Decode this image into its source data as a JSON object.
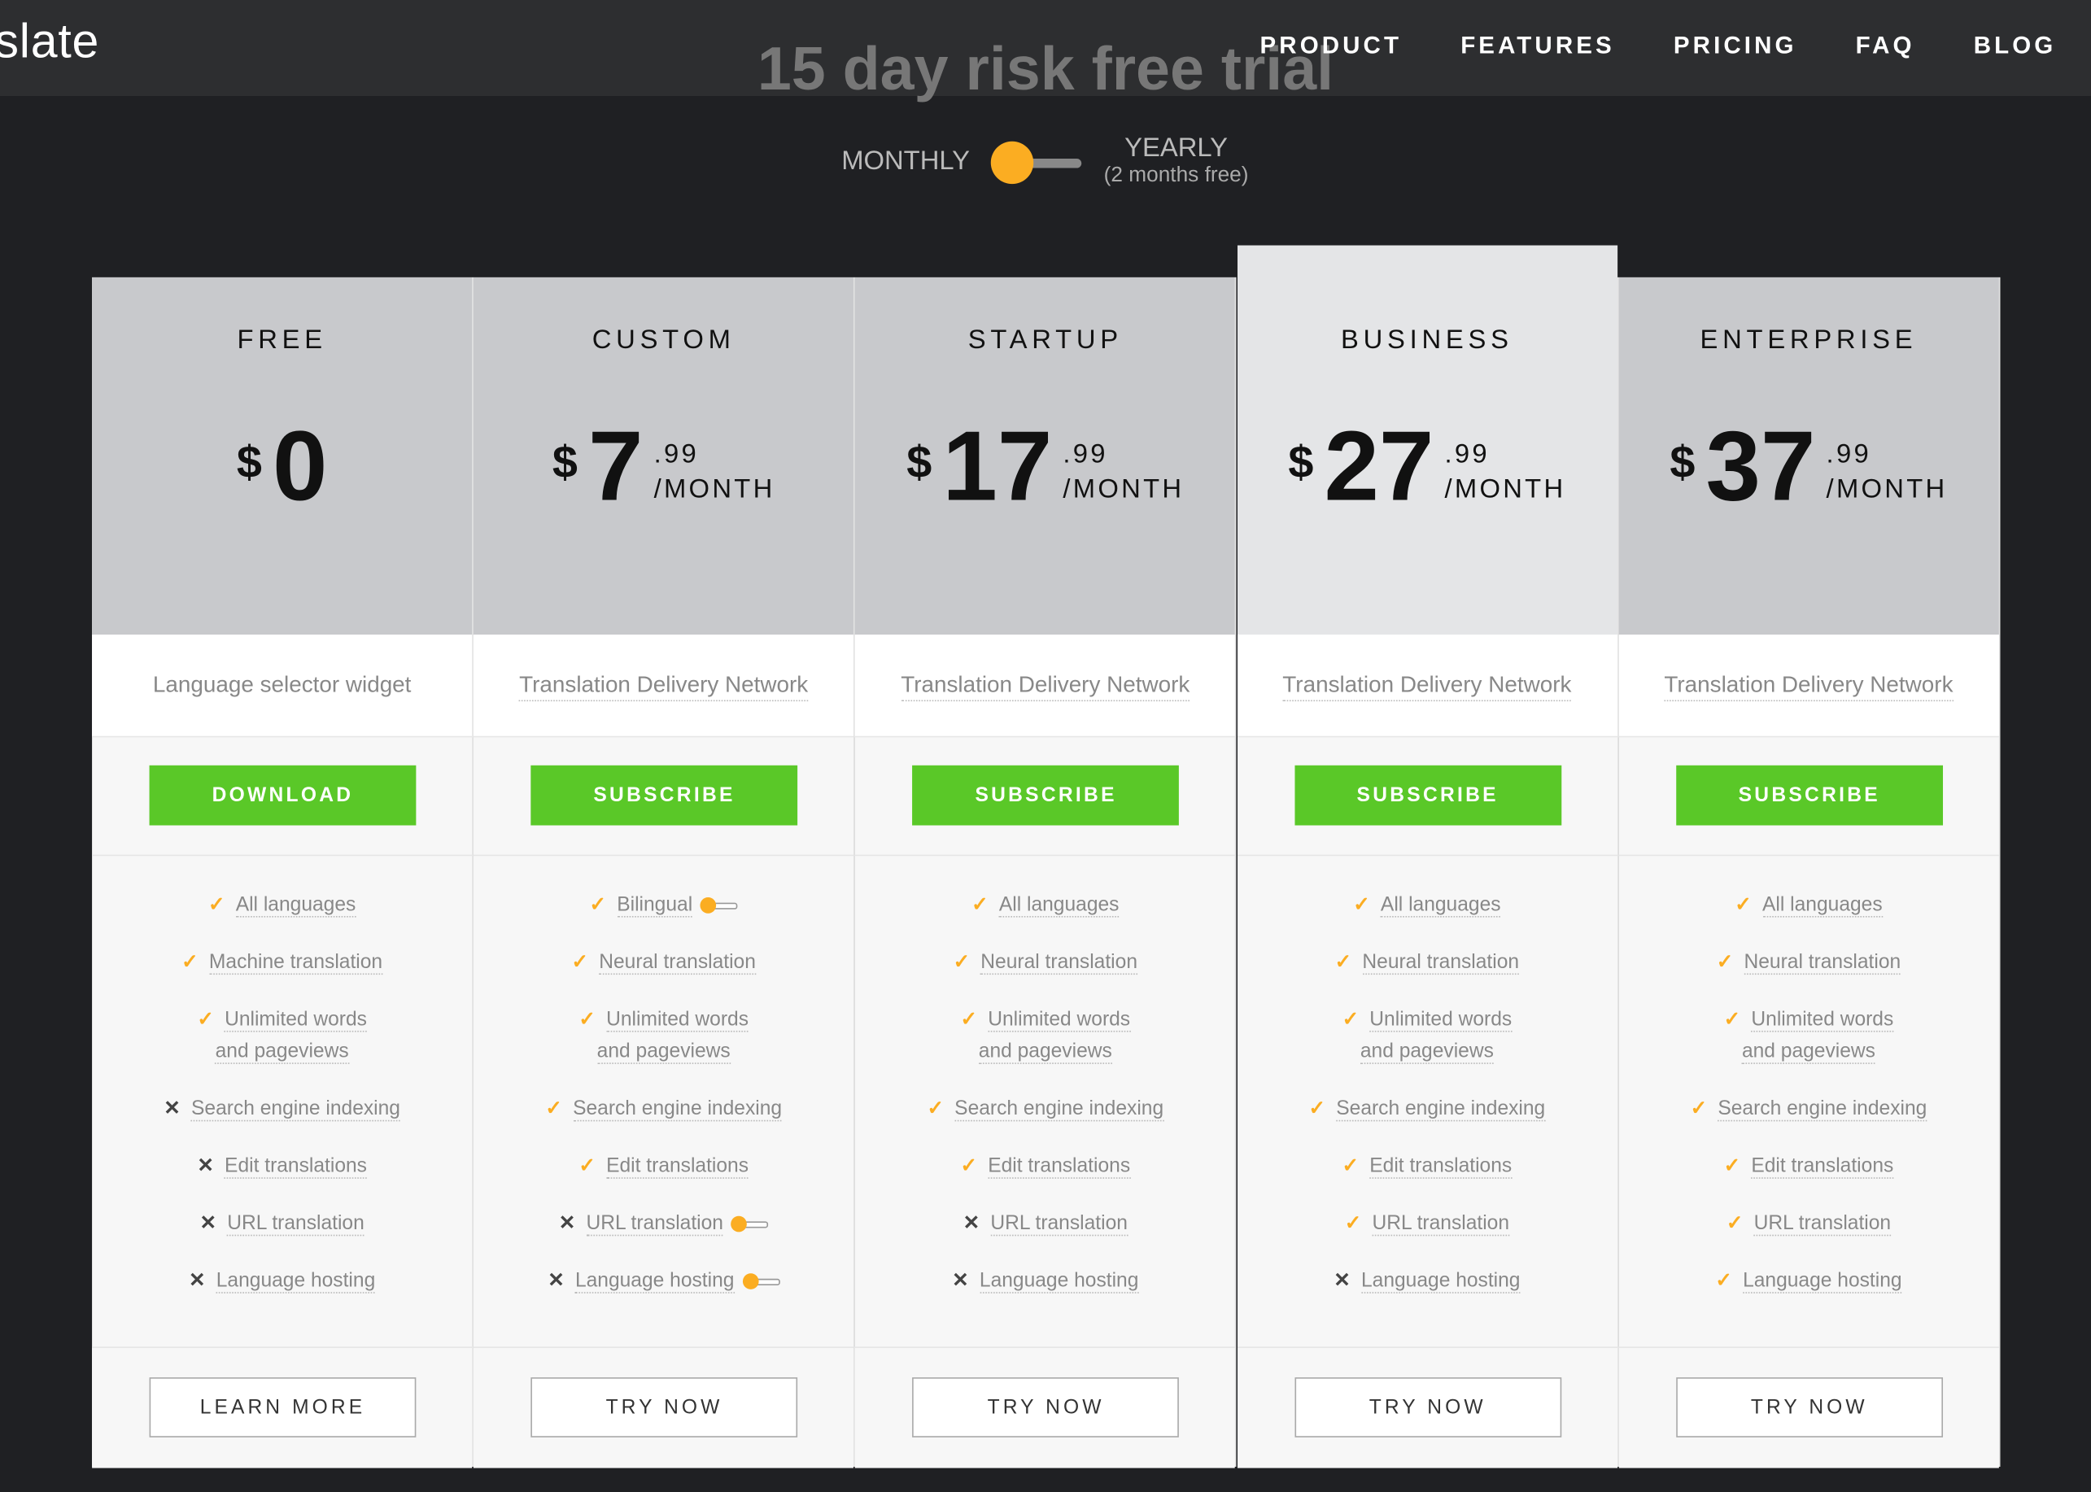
{
  "nav": {
    "logo": "slate",
    "links": [
      "PRODUCT",
      "FEATURES",
      "PRICING",
      "FAQ",
      "BLOG"
    ]
  },
  "hero": {
    "title": "15 day risk free trial"
  },
  "billing_toggle": {
    "monthly": "MONTHLY",
    "yearly": "YEARLY",
    "yearly_note": "(2 months free)",
    "selected": "monthly"
  },
  "colors": {
    "accent": "#fbad22",
    "cta": "#5ac828"
  },
  "plans": [
    {
      "name": "FREE",
      "currency": "$",
      "amount": "0",
      "cents": "",
      "period": "",
      "description": "Language selector widget",
      "cta": "DOWNLOAD",
      "secondary": "LEARN MORE",
      "highlight": false,
      "features": [
        {
          "text": "All languages",
          "included": true
        },
        {
          "text": "Machine translation",
          "included": true
        },
        {
          "text": "Unlimited words and pageviews",
          "included": true
        },
        {
          "text": "Search engine indexing",
          "included": false
        },
        {
          "text": "Edit translations",
          "included": false
        },
        {
          "text": "URL translation",
          "included": false
        },
        {
          "text": "Language hosting",
          "included": false
        }
      ]
    },
    {
      "name": "CUSTOM",
      "currency": "$",
      "amount": "7",
      "cents": ".99",
      "period": "/MONTH",
      "description": "Translation Delivery Network",
      "cta": "SUBSCRIBE",
      "secondary": "TRY NOW",
      "highlight": false,
      "features": [
        {
          "text": "Bilingual",
          "included": true,
          "toggle": true
        },
        {
          "text": "Neural translation",
          "included": true
        },
        {
          "text": "Unlimited words and pageviews",
          "included": true
        },
        {
          "text": "Search engine indexing",
          "included": true
        },
        {
          "text": "Edit translations",
          "included": true
        },
        {
          "text": "URL translation",
          "included": false,
          "toggle": true
        },
        {
          "text": "Language hosting",
          "included": false,
          "toggle": true
        }
      ]
    },
    {
      "name": "STARTUP",
      "currency": "$",
      "amount": "17",
      "cents": ".99",
      "period": "/MONTH",
      "description": "Translation Delivery Network",
      "cta": "SUBSCRIBE",
      "secondary": "TRY NOW",
      "highlight": false,
      "features": [
        {
          "text": "All languages",
          "included": true
        },
        {
          "text": "Neural translation",
          "included": true
        },
        {
          "text": "Unlimited words and pageviews",
          "included": true
        },
        {
          "text": "Search engine indexing",
          "included": true
        },
        {
          "text": "Edit translations",
          "included": true
        },
        {
          "text": "URL translation",
          "included": false
        },
        {
          "text": "Language hosting",
          "included": false
        }
      ]
    },
    {
      "name": "BUSINESS",
      "currency": "$",
      "amount": "27",
      "cents": ".99",
      "period": "/MONTH",
      "description": "Translation Delivery Network",
      "cta": "SUBSCRIBE",
      "secondary": "TRY NOW",
      "highlight": true,
      "features": [
        {
          "text": "All languages",
          "included": true
        },
        {
          "text": "Neural translation",
          "included": true
        },
        {
          "text": "Unlimited words and pageviews",
          "included": true
        },
        {
          "text": "Search engine indexing",
          "included": true
        },
        {
          "text": "Edit translations",
          "included": true
        },
        {
          "text": "URL translation",
          "included": true
        },
        {
          "text": "Language hosting",
          "included": false
        }
      ]
    },
    {
      "name": "ENTERPRISE",
      "currency": "$",
      "amount": "37",
      "cents": ".99",
      "period": "/MONTH",
      "description": "Translation Delivery Network",
      "cta": "SUBSCRIBE",
      "secondary": "TRY NOW",
      "highlight": false,
      "features": [
        {
          "text": "All languages",
          "included": true
        },
        {
          "text": "Neural translation",
          "included": true
        },
        {
          "text": "Unlimited words and pageviews",
          "included": true
        },
        {
          "text": "Search engine indexing",
          "included": true
        },
        {
          "text": "Edit translations",
          "included": true
        },
        {
          "text": "URL translation",
          "included": true
        },
        {
          "text": "Language hosting",
          "included": true
        }
      ]
    }
  ]
}
